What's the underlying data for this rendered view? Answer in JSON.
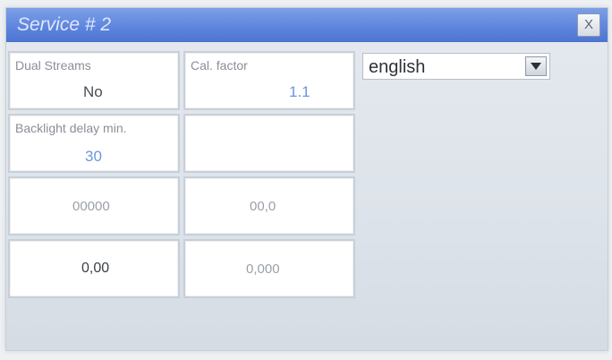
{
  "window": {
    "title": "Service # 2",
    "close_label": "X"
  },
  "tiles": {
    "dual_streams": {
      "label": "Dual Streams",
      "value": "No"
    },
    "cal_factor": {
      "label": "Cal. factor",
      "value": "1.1"
    },
    "backlight_delay": {
      "label": "Backlight delay min.",
      "value": "30"
    },
    "field_a": {
      "value": "00000"
    },
    "field_b": {
      "value": "00,0"
    },
    "field_c": {
      "value": "0,00"
    },
    "field_d": {
      "value": "0,000"
    }
  },
  "language_select": {
    "selected": "english"
  },
  "colors": {
    "titlebar": "#5f86de",
    "value_blue": "#6d95dc",
    "value_gray": "#9aa0a7",
    "value_dark": "#3a3f45"
  }
}
